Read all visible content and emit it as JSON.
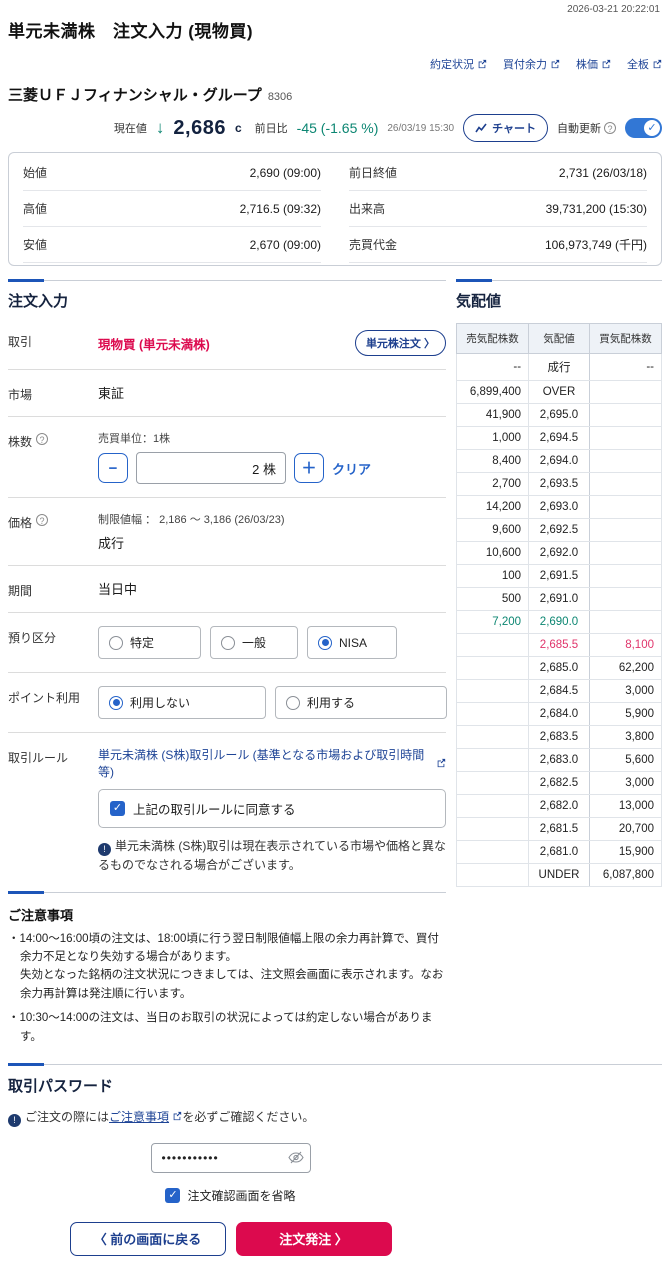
{
  "page": {
    "timestamp": "2026-03-21 20:22:01",
    "title": "単元未満株　注文入力 (現物買)"
  },
  "header_links": [
    {
      "label": "約定状況"
    },
    {
      "label": "買付余力"
    },
    {
      "label": "株価"
    },
    {
      "label": "全板"
    }
  ],
  "stock": {
    "name": "三菱ＵＦＪフィナンシャル・グループ",
    "code": "8306"
  },
  "price": {
    "current_label": "現在値",
    "arrow": "↓",
    "value": "2,686",
    "flag": "c",
    "change_label": "前日比",
    "change": "-45 (-1.65 %)",
    "time": "26/03/19 15:30",
    "chart_button": "チャート",
    "auto_update_label": "自動更新"
  },
  "quote": {
    "rows": [
      {
        "label": "始値",
        "value": "2,690 (09:00)"
      },
      {
        "label": "高値",
        "value": "2,716.5 (09:32)"
      },
      {
        "label": "安値",
        "value": "2,670 (09:00)"
      },
      {
        "label": "前日終値",
        "value": "2,731 (26/03/18)"
      },
      {
        "label": "出来高",
        "value": "39,731,200 (15:30)"
      },
      {
        "label": "売買代金",
        "value": "106,973,749 (千円)"
      }
    ]
  },
  "sections": {
    "order_entry": "注文入力",
    "board": "気配値",
    "notes": "ご注意事項",
    "password": "取引パスワード"
  },
  "form": {
    "trade": {
      "label": "取引",
      "value": "現物買 (単元未満株)",
      "unit_order_button": "単元株注文 〉"
    },
    "market": {
      "label": "市場",
      "value": "東証"
    },
    "quantity": {
      "label": "株数",
      "unit_note": "売買単位：1株",
      "value_display": "2 株",
      "minus": "−",
      "plus": "＋",
      "clear": "クリア"
    },
    "price": {
      "label": "価格",
      "limit_note": "制限値幅 ： 2,186 ～ 3,186 (26/03/23)",
      "value": "成行"
    },
    "period": {
      "label": "期間",
      "value": "当日中"
    },
    "account": {
      "label": "預り区分",
      "options": [
        "特定",
        "一般",
        "NISA"
      ],
      "selected_index": 2
    },
    "points": {
      "label": "ポイント利用",
      "options": [
        "利用しない",
        "利用する"
      ],
      "selected_index": 0
    },
    "rules": {
      "label": "取引ルール",
      "link": "単元未満株 (S株)取引ルール (基準となる市場および取引時間等)",
      "agree": "上記の取引ルールに同意する",
      "info": "単元未満株 (S株)取引は現在表示されている市場や価格と異なるものでなされる場合がございます。"
    }
  },
  "notes": [
    {
      "style": "bullet",
      "text": "・14:00～16:00頃の注文は、18:00頃に行う翌日制限値幅上限の余力再計算で、買付余力不足となり失効する場合があります。"
    },
    {
      "style": "cont",
      "text": "失効となった銘柄の注文状況につきましては、注文照会画面に表示されます。なお余力再計算は発注順に行います。"
    },
    {
      "style": "bullet",
      "text": "・10:30～14:00の注文は、当日のお取引の状況によっては約定しない場合があります。"
    }
  ],
  "password": {
    "info_prefix": "ご注文の際には",
    "info_link": "ご注意事項",
    "info_suffix": "を必ずご確認ください。",
    "value_display": "•••••••••••",
    "skip_confirm": "注文確認画面を省略",
    "back_button": "〈 前の画面に戻る",
    "submit_button": "注文発注 〉"
  },
  "book": {
    "headers": [
      "売気配株数",
      "気配値",
      "買気配株数"
    ],
    "rows": [
      {
        "sell": "--",
        "price": "成行",
        "buy": "--",
        "cls": ""
      },
      {
        "sell": "6,899,400",
        "price": "OVER",
        "buy": "",
        "cls": ""
      },
      {
        "sell": "41,900",
        "price": "2,695.0",
        "buy": "",
        "cls": ""
      },
      {
        "sell": "1,000",
        "price": "2,694.5",
        "buy": "",
        "cls": ""
      },
      {
        "sell": "8,400",
        "price": "2,694.0",
        "buy": "",
        "cls": ""
      },
      {
        "sell": "2,700",
        "price": "2,693.5",
        "buy": "",
        "cls": ""
      },
      {
        "sell": "14,200",
        "price": "2,693.0",
        "buy": "",
        "cls": ""
      },
      {
        "sell": "9,600",
        "price": "2,692.5",
        "buy": "",
        "cls": ""
      },
      {
        "sell": "10,600",
        "price": "2,692.0",
        "buy": "",
        "cls": ""
      },
      {
        "sell": "100",
        "price": "2,691.5",
        "buy": "",
        "cls": ""
      },
      {
        "sell": "500",
        "price": "2,691.0",
        "buy": "",
        "cls": ""
      },
      {
        "sell": "7,200",
        "price": "2,690.0",
        "buy": "",
        "cls": "sell-best"
      },
      {
        "sell": "",
        "price": "2,685.5",
        "buy": "8,100",
        "cls": "buy-best"
      },
      {
        "sell": "",
        "price": "2,685.0",
        "buy": "62,200",
        "cls": ""
      },
      {
        "sell": "",
        "price": "2,684.5",
        "buy": "3,000",
        "cls": ""
      },
      {
        "sell": "",
        "price": "2,684.0",
        "buy": "5,900",
        "cls": ""
      },
      {
        "sell": "",
        "price": "2,683.5",
        "buy": "3,800",
        "cls": ""
      },
      {
        "sell": "",
        "price": "2,683.0",
        "buy": "5,600",
        "cls": ""
      },
      {
        "sell": "",
        "price": "2,682.5",
        "buy": "3,000",
        "cls": ""
      },
      {
        "sell": "",
        "price": "2,682.0",
        "buy": "13,000",
        "cls": ""
      },
      {
        "sell": "",
        "price": "2,681.5",
        "buy": "20,700",
        "cls": ""
      },
      {
        "sell": "",
        "price": "2,681.0",
        "buy": "15,900",
        "cls": ""
      },
      {
        "sell": "",
        "price": "UNDER",
        "buy": "6,087,800",
        "cls": ""
      }
    ]
  },
  "colors": {
    "accent_blue": "#1c55b8",
    "navy": "#1e4496",
    "crimson": "#dc0a4e",
    "down_teal": "#0c8672",
    "book_buy_pink": "#e0346b"
  }
}
